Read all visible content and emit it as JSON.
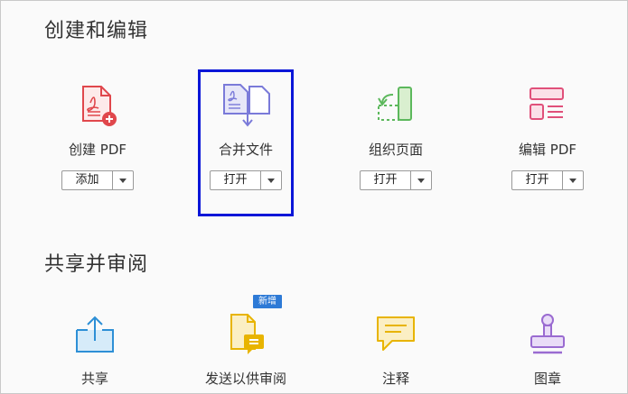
{
  "sections": [
    {
      "title": "创建和编辑",
      "tools": [
        {
          "label": "创建 PDF",
          "button": "添加",
          "icon": "create-pdf-icon"
        },
        {
          "label": "合并文件",
          "button": "打开",
          "icon": "combine-files-icon"
        },
        {
          "label": "组织页面",
          "button": "打开",
          "icon": "organize-pages-icon"
        },
        {
          "label": "编辑 PDF",
          "button": "打开",
          "icon": "edit-pdf-icon"
        }
      ]
    },
    {
      "title": "共享并审阅",
      "tools": [
        {
          "label": "共享",
          "icon": "share-icon"
        },
        {
          "label": "发送以供审阅",
          "icon": "send-for-review-icon",
          "badge": "新增"
        },
        {
          "label": "注释",
          "icon": "comment-icon"
        },
        {
          "label": "图章",
          "icon": "stamp-icon"
        }
      ]
    }
  ],
  "colors": {
    "selection_border": "#0a16d8",
    "badge_bg": "#2d7ad6",
    "create_pdf_red": "#e0474c",
    "combine_purple": "#7a7ad9",
    "organize_green": "#5cb85c",
    "edit_pink": "#e0507a",
    "share_blue": "#2d8fd6",
    "review_yellow": "#e8b400",
    "stamp_purple": "#9a6bd1"
  }
}
